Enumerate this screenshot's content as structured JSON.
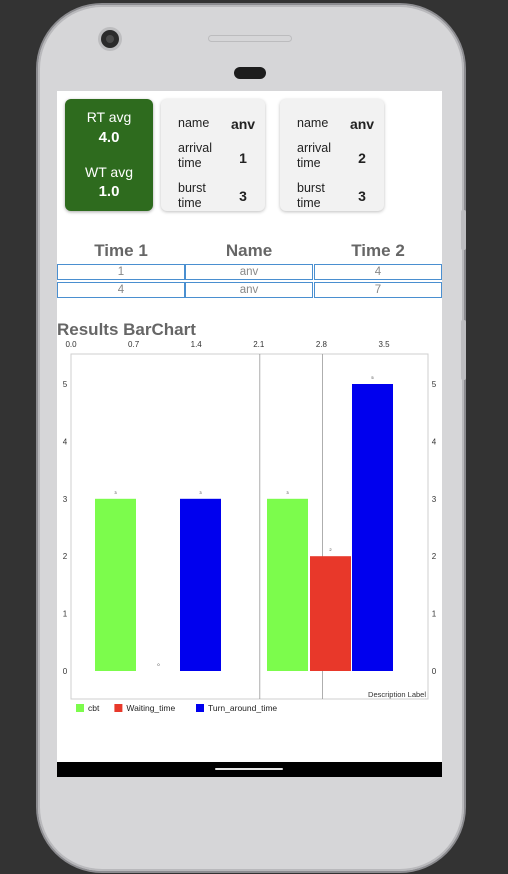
{
  "summary": {
    "rt_label": "RT avg",
    "rt_value": "4.0",
    "wt_label": "WT avg",
    "wt_value": "1.0",
    "card_color": "#2e6b1e"
  },
  "processes": [
    {
      "name_label": "name",
      "name": "anv",
      "arrival_label": "arrival time",
      "arrival": "1",
      "burst_label": "burst time",
      "burst": "3"
    },
    {
      "name_label": "name",
      "name": "anv",
      "arrival_label": "arrival time",
      "arrival": "2",
      "burst_label": "burst time",
      "burst": "3"
    }
  ],
  "table": {
    "headers": [
      "Time 1",
      "Name",
      "Time 2"
    ],
    "rows": [
      [
        "1",
        "anv",
        "4"
      ],
      [
        "4",
        "anv",
        "7"
      ]
    ],
    "border_color": "#4a8fd0"
  },
  "chart_title": "Results BarChart",
  "chart_data": {
    "type": "bar",
    "x_ticks": [
      "0.0",
      "0.7",
      "1.4",
      "2.1",
      "2.8",
      "3.5"
    ],
    "y_ticks": [
      "0",
      "1",
      "2",
      "3",
      "4",
      "5"
    ],
    "ylim": [
      0,
      5
    ],
    "groups": 2,
    "series": [
      {
        "name": "cbt",
        "color": "#7cfc4c",
        "values": [
          3,
          3
        ]
      },
      {
        "name": "Waiting_time",
        "color": "#e8382a",
        "values": [
          0,
          2
        ]
      },
      {
        "name": "Turn_around_time",
        "color": "#0000ee",
        "values": [
          3,
          5
        ]
      }
    ],
    "description": "Description Label",
    "legend_position": "bottom-left",
    "grid": true
  }
}
